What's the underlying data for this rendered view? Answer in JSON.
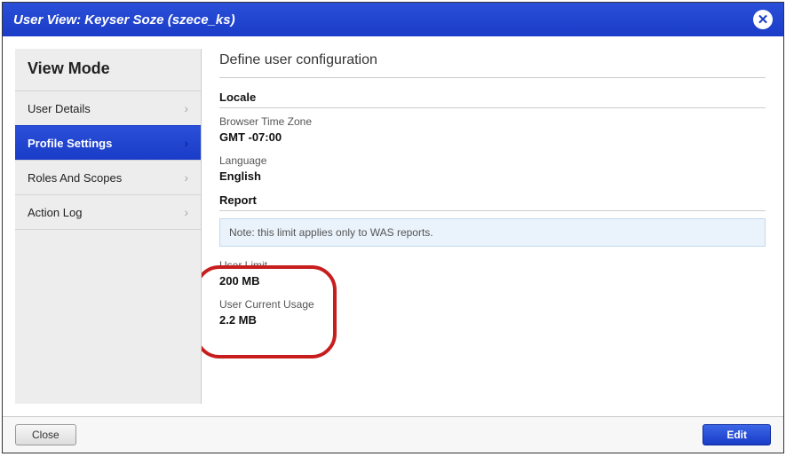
{
  "titlebar": {
    "title": "User View: Keyser Soze (szece_ks)"
  },
  "sidebar": {
    "header": "View Mode",
    "items": [
      {
        "label": "User Details",
        "active": false
      },
      {
        "label": "Profile Settings",
        "active": true
      },
      {
        "label": "Roles And Scopes",
        "active": false
      },
      {
        "label": "Action Log",
        "active": false
      }
    ]
  },
  "main": {
    "title": "Define user configuration",
    "sections": {
      "locale": {
        "heading": "Locale",
        "tz_label": "Browser Time Zone",
        "tz_value": "GMT -07:00",
        "lang_label": "Language",
        "lang_value": "English"
      },
      "report": {
        "heading": "Report",
        "note": "Note: this limit applies only to WAS reports.",
        "limit_label": "User Limit",
        "limit_value": "200 MB",
        "usage_label": "User Current Usage",
        "usage_value": "2.2 MB"
      }
    }
  },
  "footer": {
    "close": "Close",
    "edit": "Edit"
  }
}
